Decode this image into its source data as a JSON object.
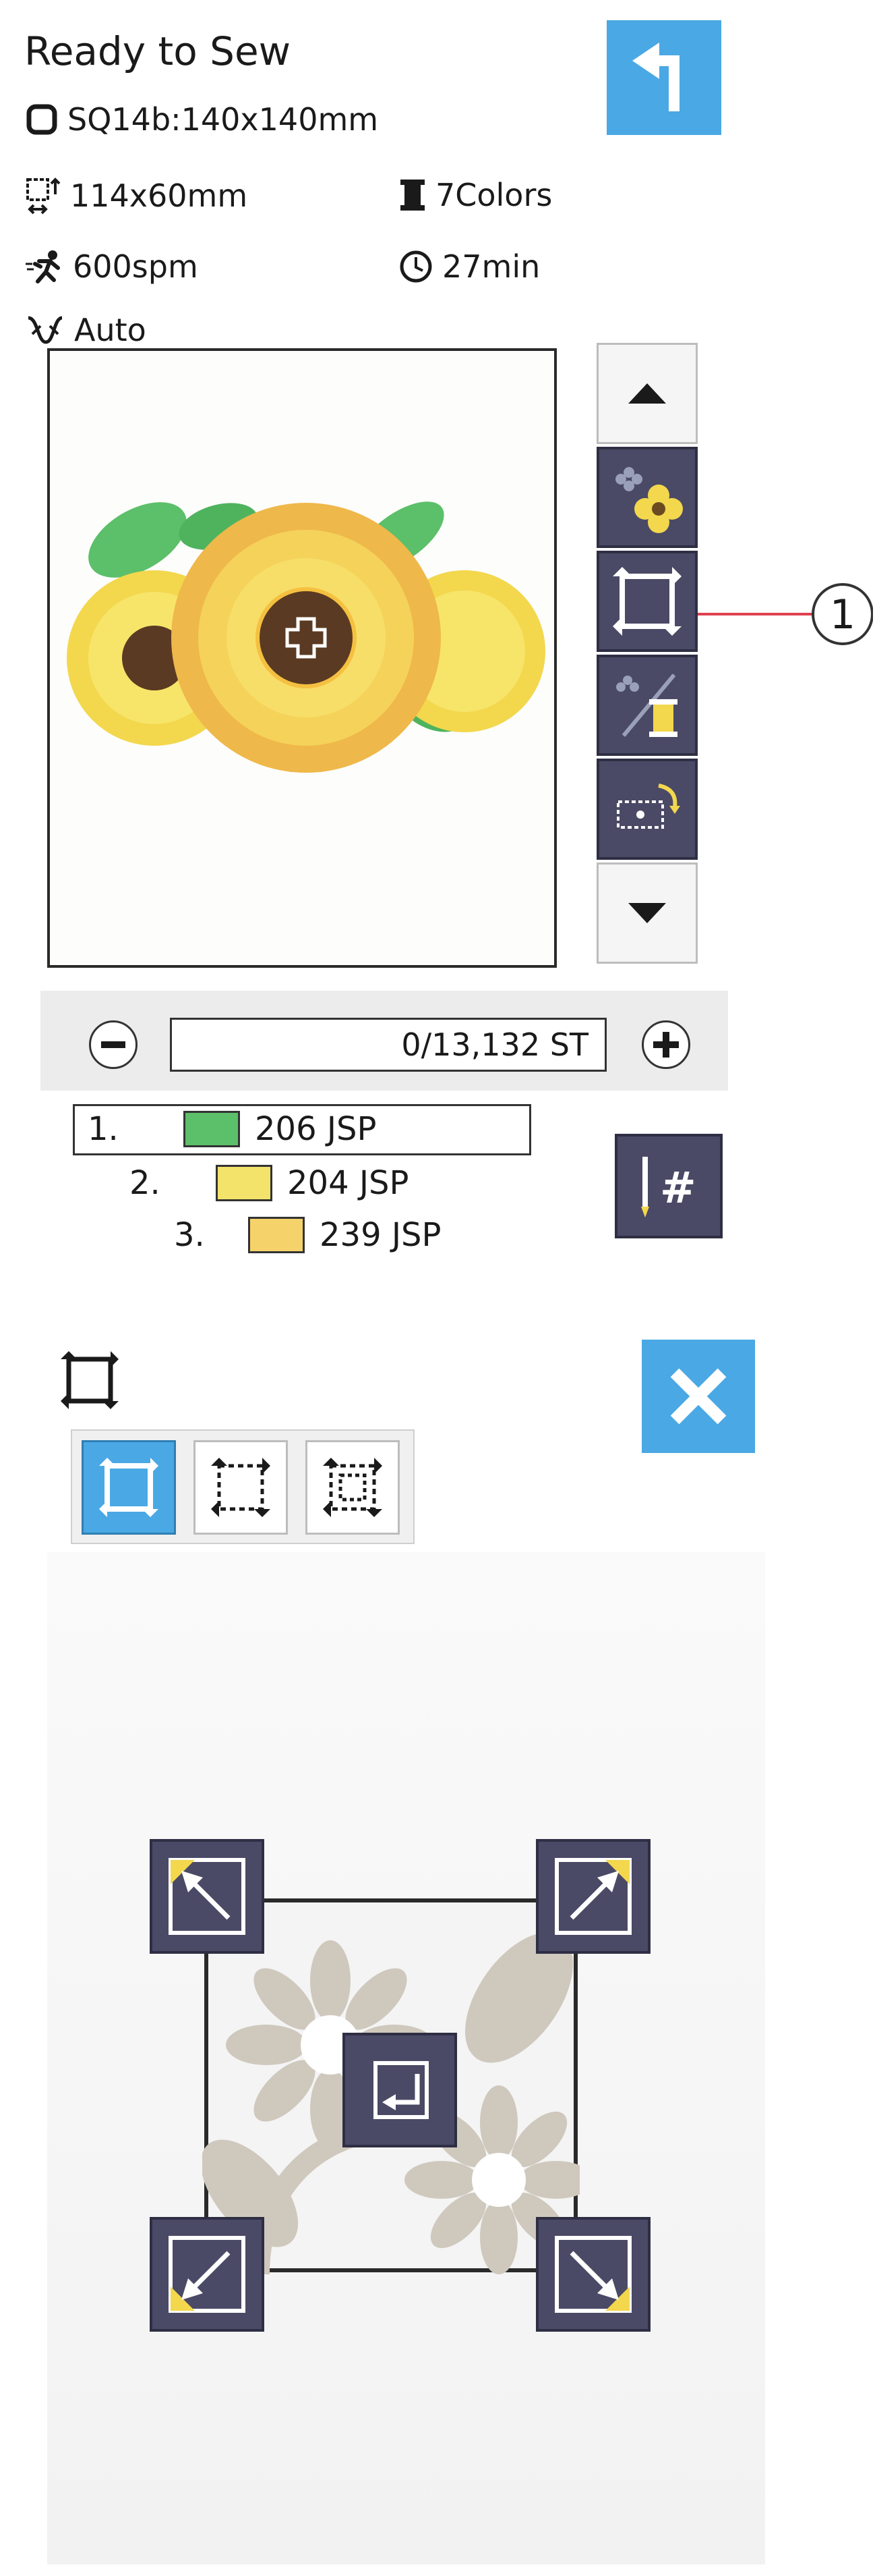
{
  "screen1": {
    "title": "Ready to Sew",
    "hoop": "SQ14b:140x140mm",
    "size": "114x60mm",
    "colors": "7Colors",
    "speed": "600spm",
    "time": "27min",
    "thread_cut": "Auto",
    "stitch_counter": "0/13,132 ST",
    "color_list": [
      {
        "index": "1.",
        "code": "206 JSP",
        "swatch": "#5cbf6a"
      },
      {
        "index": "2.",
        "code": "204 JSP",
        "swatch": "#f3e36a"
      },
      {
        "index": "3.",
        "code": "239 JSP",
        "swatch": "#f5d36a"
      }
    ],
    "callout": "1",
    "icons": {
      "back": "return-arrow-icon",
      "scroll_up": "triangle-up-icon",
      "scroll_down": "triangle-down-icon",
      "thread": "spool-icon",
      "clock": "clock-icon"
    }
  },
  "colors": {
    "accent_blue": "#4aa8e4",
    "button_dark": "#4a4a66"
  }
}
